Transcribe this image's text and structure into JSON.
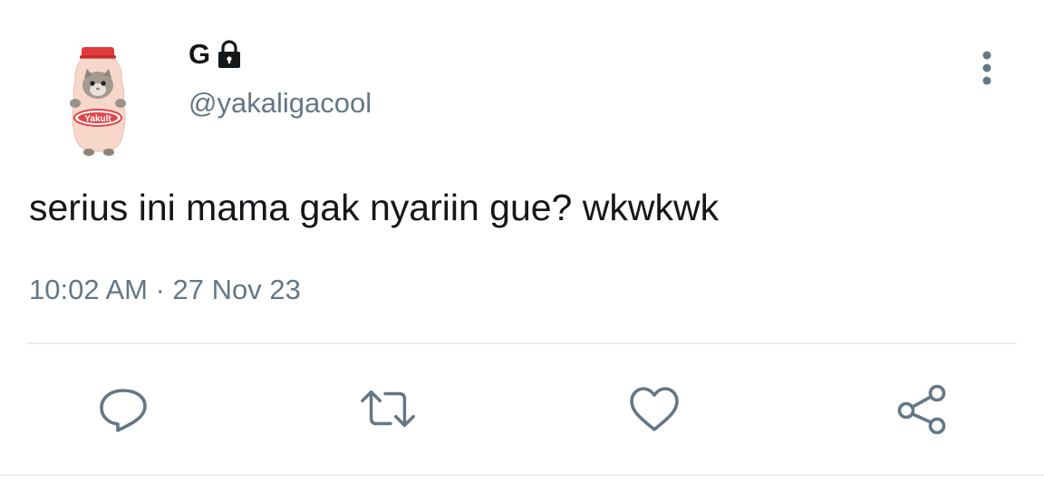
{
  "tweet": {
    "author": {
      "display_name": "G",
      "handle": "@yakaligacool",
      "avatar_icon": "yakult-bottle-cat-avatar",
      "avatar_label": "Yakult",
      "protected_icon": "lock-icon"
    },
    "text": "serius ini mama gak nyariin gue? wkwkwk",
    "timestamp": "10:02 AM · 27 Nov 23",
    "actions": {
      "reply_icon": "reply-icon",
      "retweet_icon": "retweet-icon",
      "like_icon": "heart-icon",
      "share_icon": "share-icon",
      "more_icon": "more-vertical-icon"
    }
  },
  "colors": {
    "text_primary": "#14171a",
    "text_secondary": "#657786",
    "divider": "#e6ecf0",
    "icon": "#657786"
  }
}
